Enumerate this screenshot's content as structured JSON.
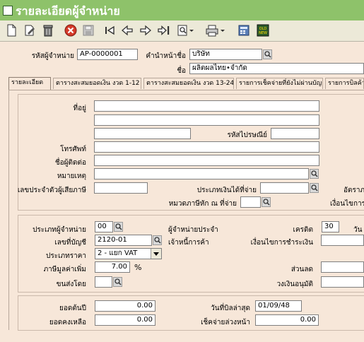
{
  "window": {
    "title": "รายละเอียดผู้จำหน่าย"
  },
  "toolbar": {
    "icons": [
      "new-icon",
      "edit-icon",
      "delete-icon",
      "cancel-icon",
      "save-icon",
      "first-icon",
      "prev-icon",
      "next-icon",
      "last-icon",
      "find-icon",
      "print-icon",
      "calculator-icon",
      "old-new-icon"
    ],
    "old_new_text": "OLD NEW"
  },
  "header": {
    "vendor_code_label": "รหัสผู้จำหน่าย",
    "vendor_code": "AP-0000001",
    "prefix_label": "คำนำหน้าชื่อ",
    "prefix": "บริษัท",
    "name_label": "ชื่อ",
    "name": "ผลิตผลไทย•จำกัด"
  },
  "tabs": [
    "รายละเอียด",
    "ตารางสะสมยอดเงิน งวด 1-12",
    "ตารางสะสมยอดเงิน งวด 13-24",
    "รายการเช็คจ่ายที่ยังไม่ผ่านบัญชี",
    "รายการบิลค้างจ่าย"
  ],
  "details": {
    "address_label": "ที่อยู่",
    "postcode_label": "รหัสไปรษณีย์",
    "phone_label": "โทรศัพท์",
    "contact_label": "ชื่อผู้ติดต่อ",
    "note_label": "หมายเหตุ",
    "tax_id_label": "เลขประจำตัวผู้เสียภาษี",
    "income_type_label": "ประเภทเงินได้ที่จ่าย",
    "rate_label": "อัตราภ",
    "withholding_label": "หมวดภาษีหัก ณ ที่จ่าย",
    "condition_label": "เงื่อนไขการ"
  },
  "account": {
    "vendor_type_label": "ประเภทผู้จำหน่าย",
    "vendor_type": "00",
    "vendor_type_desc": "ผู้จำหน่ายประจำ",
    "credit_label": "เครดิต",
    "credit_days": "30",
    "days_unit": "วัน",
    "account_no_label": "เลขที่บัญชี",
    "account_no": "2120-01",
    "account_desc": "เจ้าหนี้การค้า",
    "payment_terms_label": "เงื่อนไขการชำระเงิน",
    "price_type_label": "ประเภทราคา",
    "price_type": "2 - แยก VAT",
    "vat_label": "ภาษีมูลค่าเพิ่ม",
    "vat_rate": "7.00",
    "vat_unit": "%",
    "discount_label": "ส่วนลด",
    "ship_by_label": "ขนส่งโดย",
    "credit_limit_label": "วงเงินอนุมัติ"
  },
  "balance": {
    "opening_label": "ยอดต้นปี",
    "opening": "0.00",
    "remaining_label": "ยอดคงเหลือ",
    "remaining": "0.00",
    "last_bill_label": "วันที่บิลล่าสุด",
    "last_bill_date": "01/09/48",
    "advance_check_label": "เช็คจ่ายล่วงหน้า",
    "advance_check": "0.00"
  }
}
